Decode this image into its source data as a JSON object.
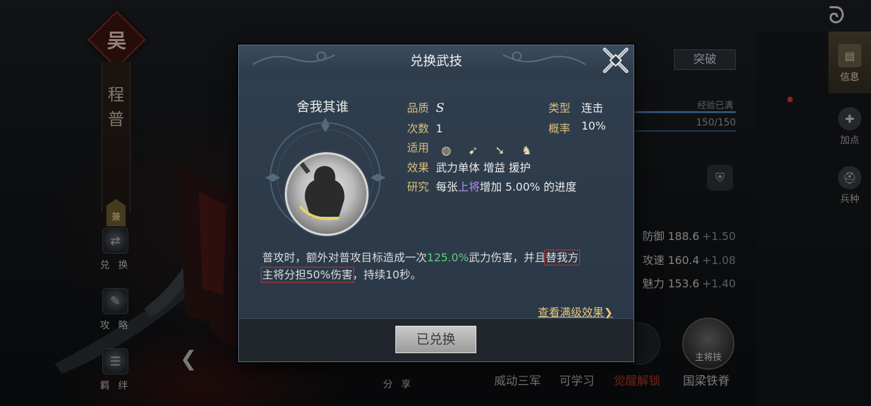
{
  "background": {
    "hero_faction": "吴",
    "hero_name": "程普",
    "hero_badge": "兼",
    "side_buttons": [
      {
        "label": "兑 换",
        "icon": "exchange-icon"
      },
      {
        "label": "攻 略",
        "icon": "guide-icon"
      },
      {
        "label": "羁 绊",
        "icon": "bond-icon"
      }
    ],
    "share_label": "分 享",
    "right_tabs": [
      {
        "label": "信息",
        "icon": "scroll-icon"
      },
      {
        "label": "加点",
        "icon": "points-icon"
      },
      {
        "label": "兵种",
        "icon": "helmet-icon"
      }
    ],
    "breakthrough_label": "突破",
    "exp_label": "经验已满",
    "exp_value": "150/150",
    "exp_fraction": 1.0,
    "stats": [
      {
        "name": "防御",
        "value": "188.6",
        "inc": "+1.50"
      },
      {
        "name": "攻速",
        "value": "160.4",
        "inc": "+1.08"
      },
      {
        "name": "魅力",
        "value": "153.6",
        "inc": "+1.40"
      }
    ],
    "bottom_options": [
      "威动三军",
      "可学习",
      "觉醒解锁",
      "国梁铁脊"
    ],
    "master_skill_label": "主将技"
  },
  "modal": {
    "title": "兑换武技",
    "skill_name": "舍我其谁",
    "quality_label": "品质",
    "quality_value": "S",
    "type_label": "类型",
    "type_value": "连击",
    "count_label": "次数",
    "count_value": "1",
    "rate_label": "概率",
    "rate_value": "10%",
    "applicable_label": "适用",
    "applicable_icons": [
      "shield-icon",
      "bow-icon",
      "spear-icon",
      "horse-icon"
    ],
    "effect_label": "效果",
    "effect_value": "武力单体 增益 援护",
    "research_label": "研究",
    "research_pre": "每张",
    "research_highlight": "上将",
    "research_post": "增加 5.00% 的进度",
    "desc_part1": "普攻时，额外对普攻目标造成一次",
    "desc_pct": "125.0%",
    "desc_part2": "武力伤害，并且",
    "desc_box1": "替我方",
    "desc_box2": "主将分担50%伤害",
    "desc_part3": "，持续10秒。",
    "full_effect_link": "查看满级效果",
    "full_effect_arrow": "❯",
    "redeem_button": "已兑换"
  },
  "colors": {
    "key_gold": "#d8bf7a",
    "highlight_purple": "#b68cf0",
    "percent_green": "#5fd07c",
    "box_red": "#c2372c"
  }
}
